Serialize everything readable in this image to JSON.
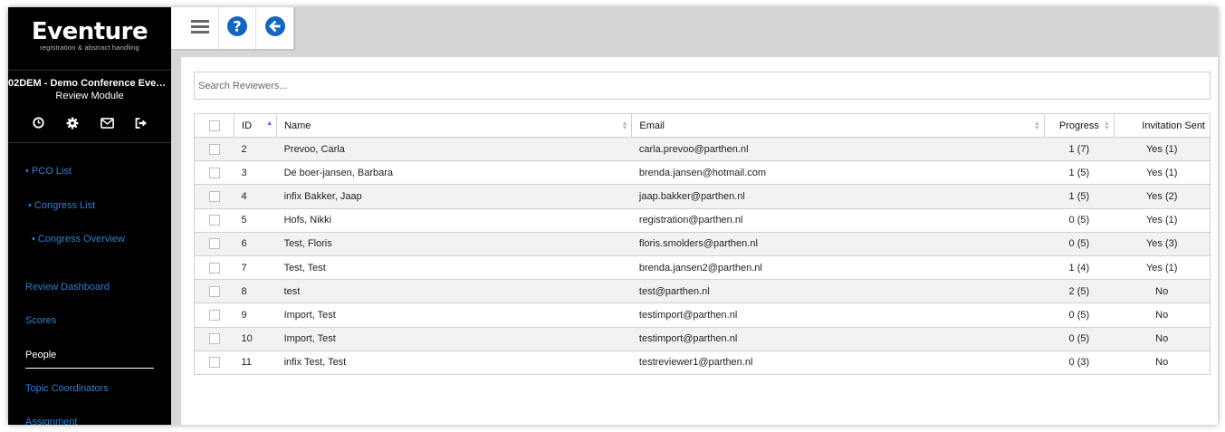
{
  "sidebar": {
    "logo": "Eventure",
    "tagline": "registration & abstract handling",
    "event_name": "02DEM - Demo Conference Event…",
    "module_name": "Review Module",
    "icons": [
      "clock-icon",
      "gear-icon",
      "envelope-icon",
      "sign-out-icon"
    ],
    "items": [
      {
        "label": "• PCO List"
      },
      {
        "label": "• Congress List"
      },
      {
        "label": "• Congress Overview"
      },
      {
        "label": "Review Dashboard"
      },
      {
        "label": "Scores"
      },
      {
        "label": "People",
        "active": true
      },
      {
        "label": "Topic Coordinators"
      },
      {
        "label": "Assignment"
      }
    ]
  },
  "toolbar": {
    "icons": [
      "hamburger-menu-icon",
      "help-icon",
      "back-arrow-icon"
    ],
    "accent": "#1565c0"
  },
  "search": {
    "placeholder": "Search Reviewers...",
    "value": ""
  },
  "table": {
    "columns": [
      "",
      "ID",
      "Name",
      "Email",
      "Progress",
      "Invitation Sent"
    ],
    "rows": [
      {
        "id": "2",
        "name": "Prevoo, Carla",
        "email": "carla.prevoo@parthen.nl",
        "progress": "1 (7)",
        "invitation": "Yes (1)"
      },
      {
        "id": "3",
        "name": "De boer-jansen, Barbara",
        "email": "brenda.jansen@hotmail.com",
        "progress": "1 (5)",
        "invitation": "Yes (1)"
      },
      {
        "id": "4",
        "name": "infix Bakker, Jaap",
        "email": "jaap.bakker@parthen.nl",
        "progress": "1 (5)",
        "invitation": "Yes (2)"
      },
      {
        "id": "5",
        "name": "Hofs, Nikki",
        "email": "registration@parthen.nl",
        "progress": "0 (5)",
        "invitation": "Yes (1)"
      },
      {
        "id": "6",
        "name": "Test, Floris",
        "email": "floris.smolders@parthen.nl",
        "progress": "0 (5)",
        "invitation": "Yes (3)"
      },
      {
        "id": "7",
        "name": "Test, Test",
        "email": "brenda.jansen2@parthen.nl",
        "progress": "1 (4)",
        "invitation": "Yes (1)"
      },
      {
        "id": "8",
        "name": "test",
        "email": "test@parthen.nl",
        "progress": "2 (5)",
        "invitation": "No"
      },
      {
        "id": "9",
        "name": "Import, Test",
        "email": "testimport@parthen.nl",
        "progress": "0 (5)",
        "invitation": "No"
      },
      {
        "id": "10",
        "name": "Import, Test",
        "email": "testimport@parthen.nl",
        "progress": "0 (5)",
        "invitation": "No"
      },
      {
        "id": "11",
        "name": "infix Test, Test",
        "email": "testreviewer1@parthen.nl",
        "progress": "0 (3)",
        "invitation": "No"
      }
    ]
  }
}
